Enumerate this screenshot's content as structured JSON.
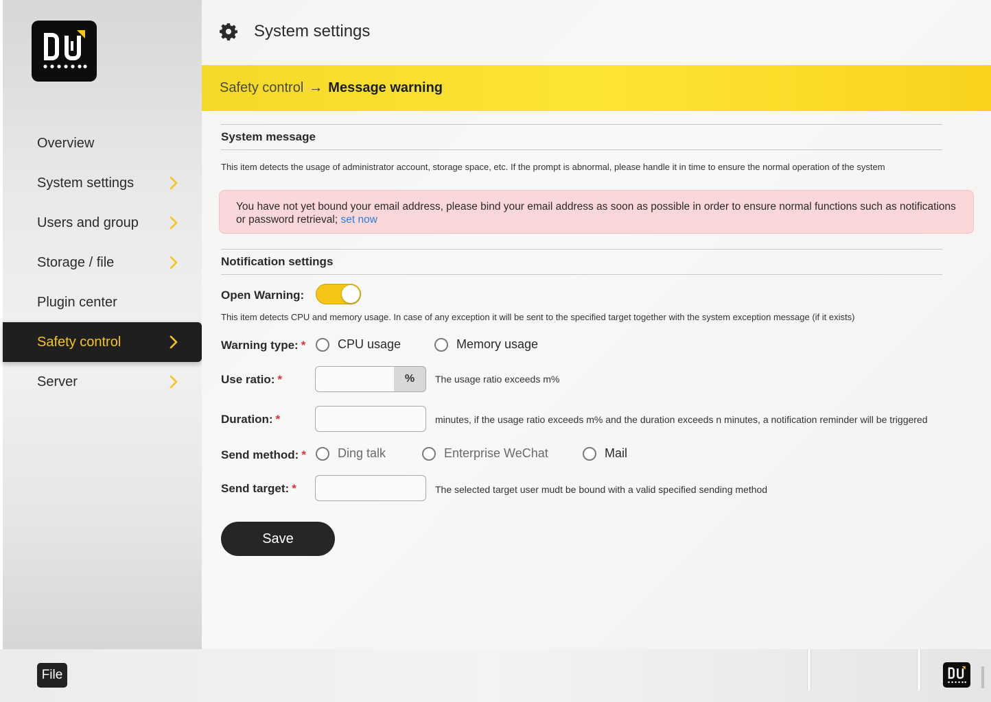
{
  "app": {
    "logo_name": "logo",
    "header_title": "System settings",
    "header_icon": "gear-icon"
  },
  "sidebar": {
    "items": [
      {
        "label": "Overview",
        "has_chevron": false,
        "active": false
      },
      {
        "label": "System settings",
        "has_chevron": true,
        "active": false
      },
      {
        "label": "Users and group",
        "has_chevron": true,
        "active": false
      },
      {
        "label": "Storage / file",
        "has_chevron": true,
        "active": false
      },
      {
        "label": "Plugin center",
        "has_chevron": false,
        "active": false
      },
      {
        "label": "Safety control",
        "has_chevron": true,
        "active": true
      },
      {
        "label": "Server",
        "has_chevron": true,
        "active": false
      }
    ]
  },
  "breadcrumb": {
    "parent": "Safety control",
    "separator": "→",
    "current": "Message warning"
  },
  "system_message": {
    "heading": "System message",
    "description": "This item detects the usage of administrator account, storage space, etc. If the prompt is abnormal, please handle it in time to ensure the normal operation of the system"
  },
  "alert": {
    "text": "You have not yet bound your email address, please bind your email address as soon as possible in order to ensure normal functions such as notifications or password retrieval; ",
    "link": "set now"
  },
  "notification": {
    "heading": "Notification settings",
    "open_warning_label": "Open Warning:",
    "open_warning_on": true,
    "description": "This item detects CPU and memory usage. In case of any exception it will be sent to the specified target together with the system exception message (if it exists)",
    "warning_type": {
      "label": "Warning type:",
      "required": "*",
      "options": [
        "CPU usage",
        "Memory usage"
      ]
    },
    "use_ratio": {
      "label": "Use ratio:",
      "required": "*",
      "value": "",
      "suffix": "%",
      "hint": "The usage ratio exceeds m%"
    },
    "duration": {
      "label": "Duration:",
      "required": "*",
      "value": "",
      "hint": "minutes, if the usage ratio exceeds m% and the duration exceeds n minutes, a notification reminder will be triggered"
    },
    "send_method": {
      "label": "Send method:",
      "required": "*",
      "options": [
        "Ding talk",
        "Enterprise WeChat",
        "Mail"
      ]
    },
    "send_target": {
      "label": "Send target:",
      "required": "*",
      "value": "",
      "hint": "The selected target user mudt be bound with a valid specified sending method"
    },
    "save_label": "Save"
  },
  "footer": {
    "file_label": "File"
  },
  "colors": {
    "accent": "#f5c518",
    "sidebar_active_bg": "#1f1f1f",
    "alert_bg": "#fbd7da",
    "link": "#2a7ddb",
    "required": "#e0303a",
    "button_bg": "#262626"
  }
}
